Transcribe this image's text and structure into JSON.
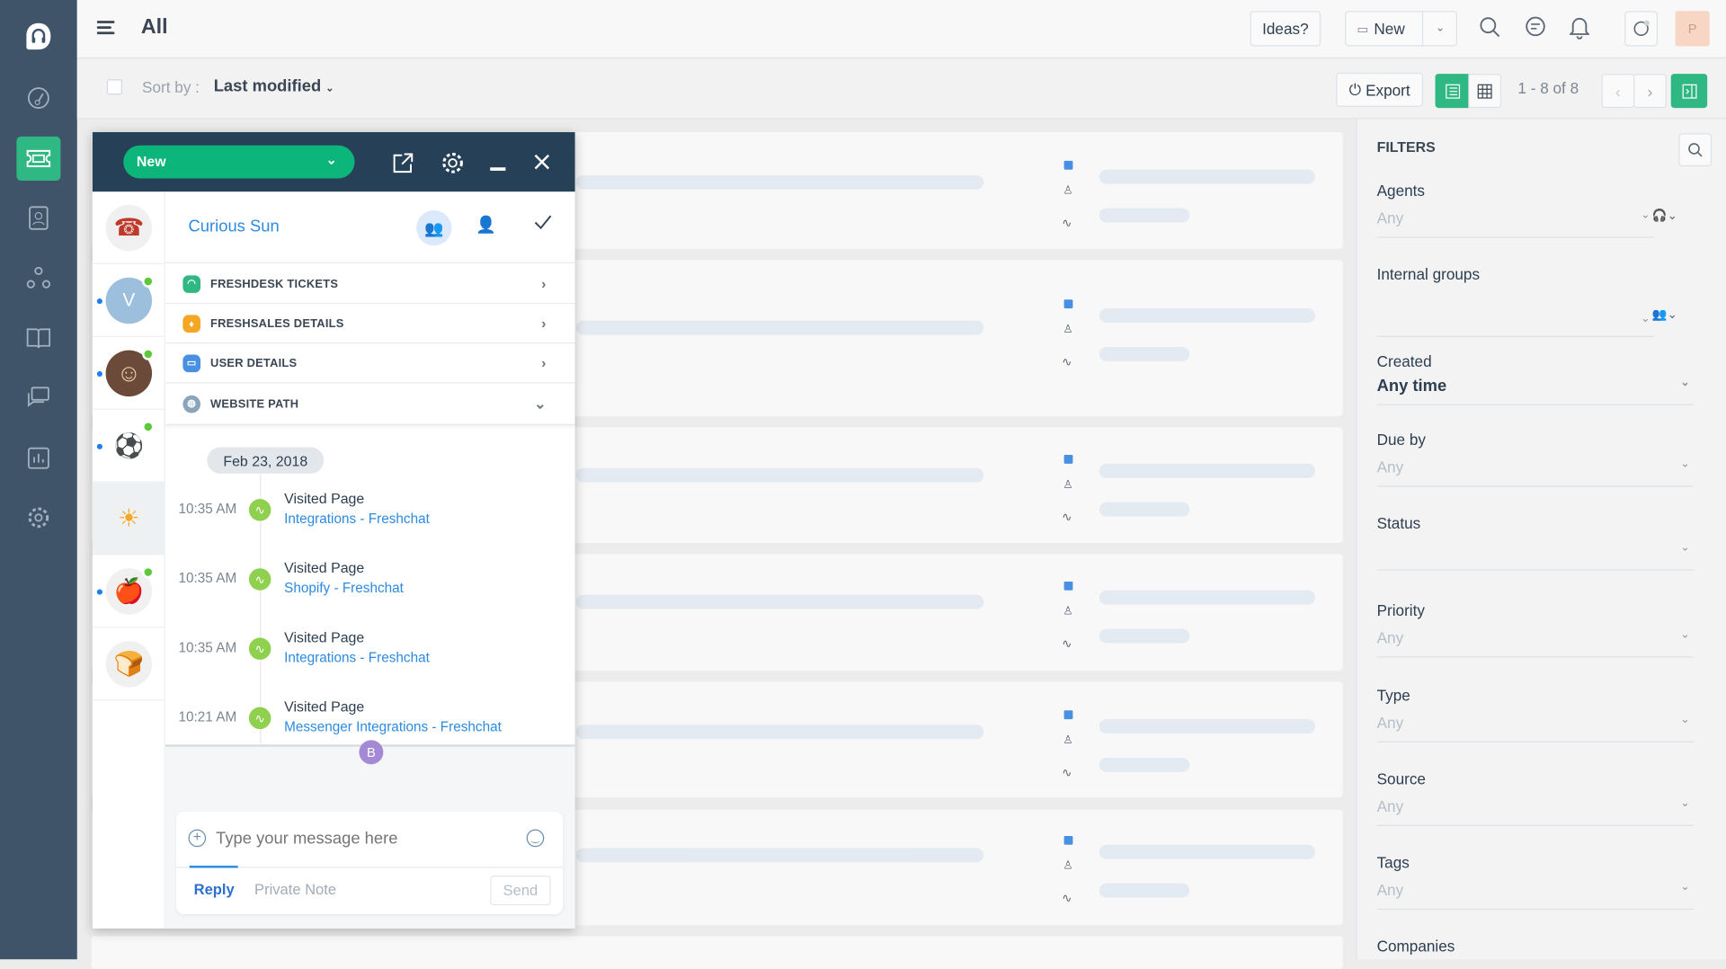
{
  "header": {
    "title": "All",
    "ideas_label": "Ideas?",
    "new_label": "New",
    "avatar_initial": "P"
  },
  "sortbar": {
    "sort_label": "Sort by :",
    "sort_value": "Last modified",
    "export_label": "Export",
    "pagination": "1 - 8 of 8"
  },
  "colors": {
    "sidebar": "#3f5468",
    "accent_green": "#2fb883",
    "chat_header": "#264157",
    "link_blue": "#2d8ae0"
  },
  "chat": {
    "status": "New",
    "contact_name": "Curious Sun",
    "avatars": [
      {
        "name": "phone",
        "initial": ""
      },
      {
        "name": "v",
        "initial": "V"
      },
      {
        "name": "person-photo",
        "initial": ""
      },
      {
        "name": "soccer-ball",
        "initial": ""
      },
      {
        "name": "sun",
        "initial": ""
      },
      {
        "name": "apple",
        "initial": ""
      },
      {
        "name": "toast",
        "initial": ""
      }
    ],
    "sections": [
      {
        "label": "FRESHDESK TICKETS"
      },
      {
        "label": "FRESHSALES DETAILS"
      },
      {
        "label": "USER DETAILS"
      },
      {
        "label": "WEBSITE PATH"
      }
    ],
    "date_chip": "Feb 23, 2018",
    "timeline": [
      {
        "time": "10:35 AM",
        "title": "Visited Page",
        "link": "Integrations - Freshchat"
      },
      {
        "time": "10:35 AM",
        "title": "Visited Page",
        "link": "Shopify - Freshchat"
      },
      {
        "time": "10:35 AM",
        "title": "Visited Page",
        "link": "Integrations - Freshchat"
      },
      {
        "time": "10:21 AM",
        "title": "Visited Page",
        "link": "Messenger Integrations - Freshchat"
      }
    ],
    "bubble_initial": "B",
    "composer": {
      "placeholder": "Type your message here",
      "reply_tab": "Reply",
      "note_tab": "Private Note",
      "send_label": "Send"
    }
  },
  "filters": {
    "title": "FILTERS",
    "fields": [
      {
        "label": "Agents",
        "value": "Any"
      },
      {
        "label": "Internal groups",
        "value": ""
      },
      {
        "label": "Created",
        "value": "Any time"
      },
      {
        "label": "Due by",
        "value": "Any"
      },
      {
        "label": "Status",
        "value": ""
      },
      {
        "label": "Priority",
        "value": "Any"
      },
      {
        "label": "Type",
        "value": "Any"
      },
      {
        "label": "Source",
        "value": "Any"
      },
      {
        "label": "Tags",
        "value": "Any"
      },
      {
        "label": "Companies",
        "value": ""
      }
    ]
  }
}
